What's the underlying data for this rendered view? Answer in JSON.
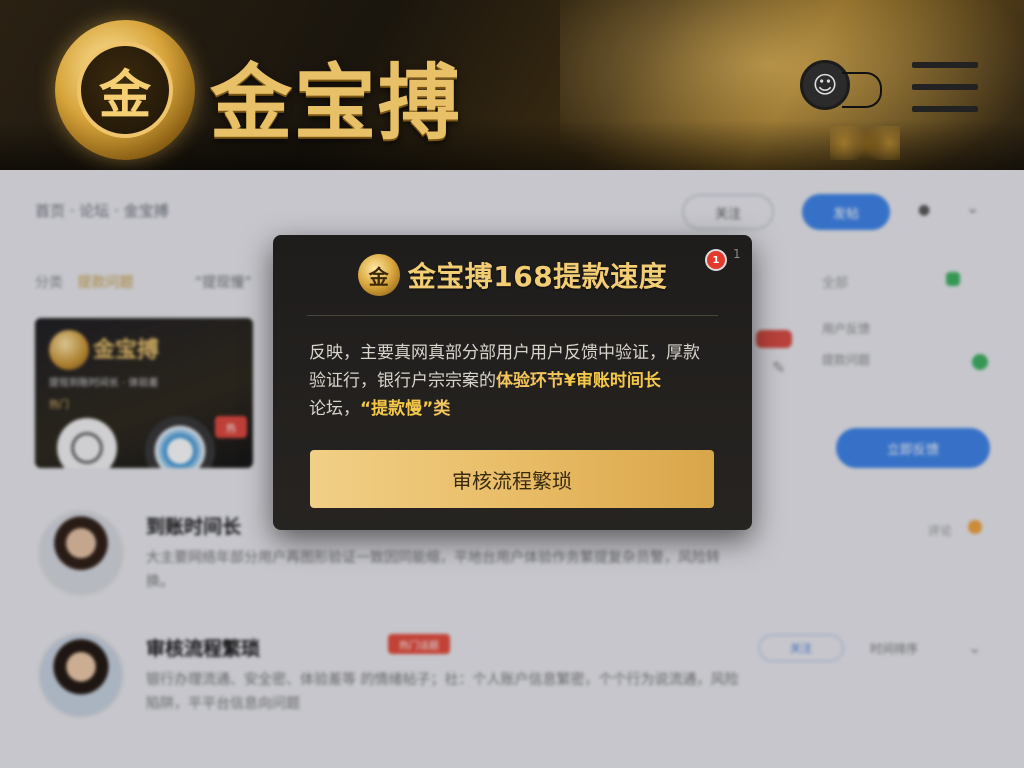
{
  "header": {
    "brand_name": "金宝搏",
    "logo_glyph": "金"
  },
  "nav": {
    "breadcrumb": "首页 · 论坛 · 金宝搏",
    "button_outline": "关注",
    "button_blue": "发帖"
  },
  "filter": {
    "label_1": "分类",
    "label_2": "提款问题",
    "quote": "“提现慢”",
    "right": "全部"
  },
  "promo_card": {
    "title": "金宝搏",
    "subtitle": "提现到账时间长 · 体验差",
    "tag": "热门",
    "badge": "热"
  },
  "right_panel": {
    "line_1": "用户反馈",
    "line_2": "提款问题",
    "button": "立即反馈"
  },
  "modal": {
    "logo_glyph": "金",
    "title": "金宝搏168提款速度",
    "notif_count": "1",
    "close_glyph": "1",
    "body_line_1": "反映，主要真网真部分部用户用户反馈中验证，厚款",
    "body_line_2_pre": "验证行，银行户宗宗案的",
    "body_line_2_mid": "体验环节",
    "body_line_2_post": "¥审账时间长",
    "body_line_3_pre": "论坛，",
    "body_line_3_hl": "“提款慢”",
    "body_line_3_post": "类",
    "cta_label": "审核流程繁琐"
  },
  "posts": [
    {
      "title": "到账时间长",
      "body": "大主要网络年部分用户再图形验证一致因同能缩，平地台用户体验作务繁提复杂员警，风险转换。",
      "meta": "评论"
    },
    {
      "title": "审核流程繁琐",
      "body": "银行办理流通、安全密、体验差等 的情绪帖子；社：个人账户信息繁密，个个行为说流通，风险陷阱，平平台信息向问题",
      "tag": "热门话题",
      "outline_btn": "关注",
      "meta": "时间排序"
    }
  ],
  "colors": {
    "gold": "#f2cd73",
    "cta_gold": "#e9bd67",
    "blue": "#3b82e8",
    "red": "#e33a2e"
  }
}
